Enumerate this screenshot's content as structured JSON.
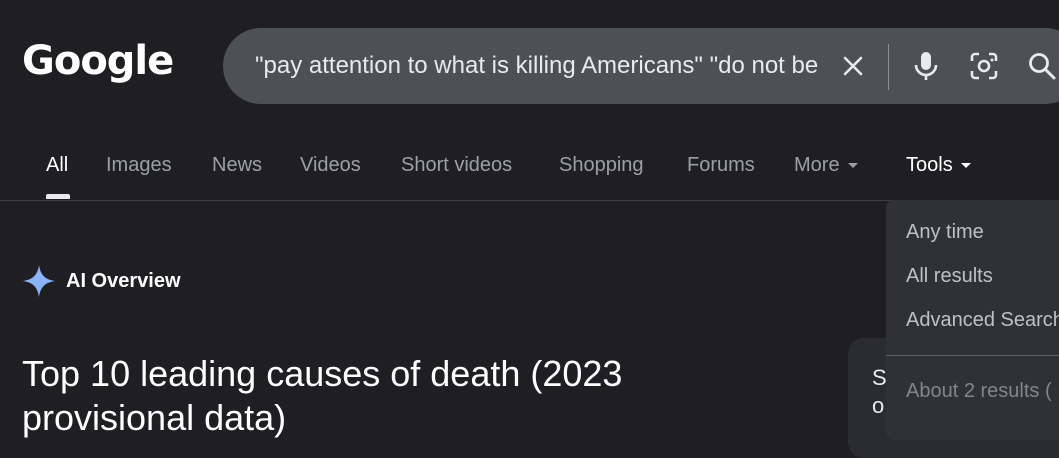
{
  "logo": "Google",
  "search": {
    "query": "\"pay attention to what is killing Americans\" \"do not be"
  },
  "tabs": [
    {
      "label": "All"
    },
    {
      "label": "Images"
    },
    {
      "label": "News"
    },
    {
      "label": "Videos"
    },
    {
      "label": "Short videos"
    },
    {
      "label": "Shopping"
    },
    {
      "label": "Forums"
    },
    {
      "label": "More"
    },
    {
      "label": "Tools"
    }
  ],
  "ai_overview": {
    "label": "AI Overview",
    "heading": "Top 10 leading causes of death (2023 provisional data)"
  },
  "side_card": {
    "text": "S\no"
  },
  "tools_menu": {
    "items": [
      "Any time",
      "All results",
      "Advanced Search"
    ],
    "results_count": "About 2 results ("
  },
  "colors": {
    "background": "#1f1f23",
    "searchbar": "#4d5156",
    "accent_blue": "#8ab4f8"
  }
}
